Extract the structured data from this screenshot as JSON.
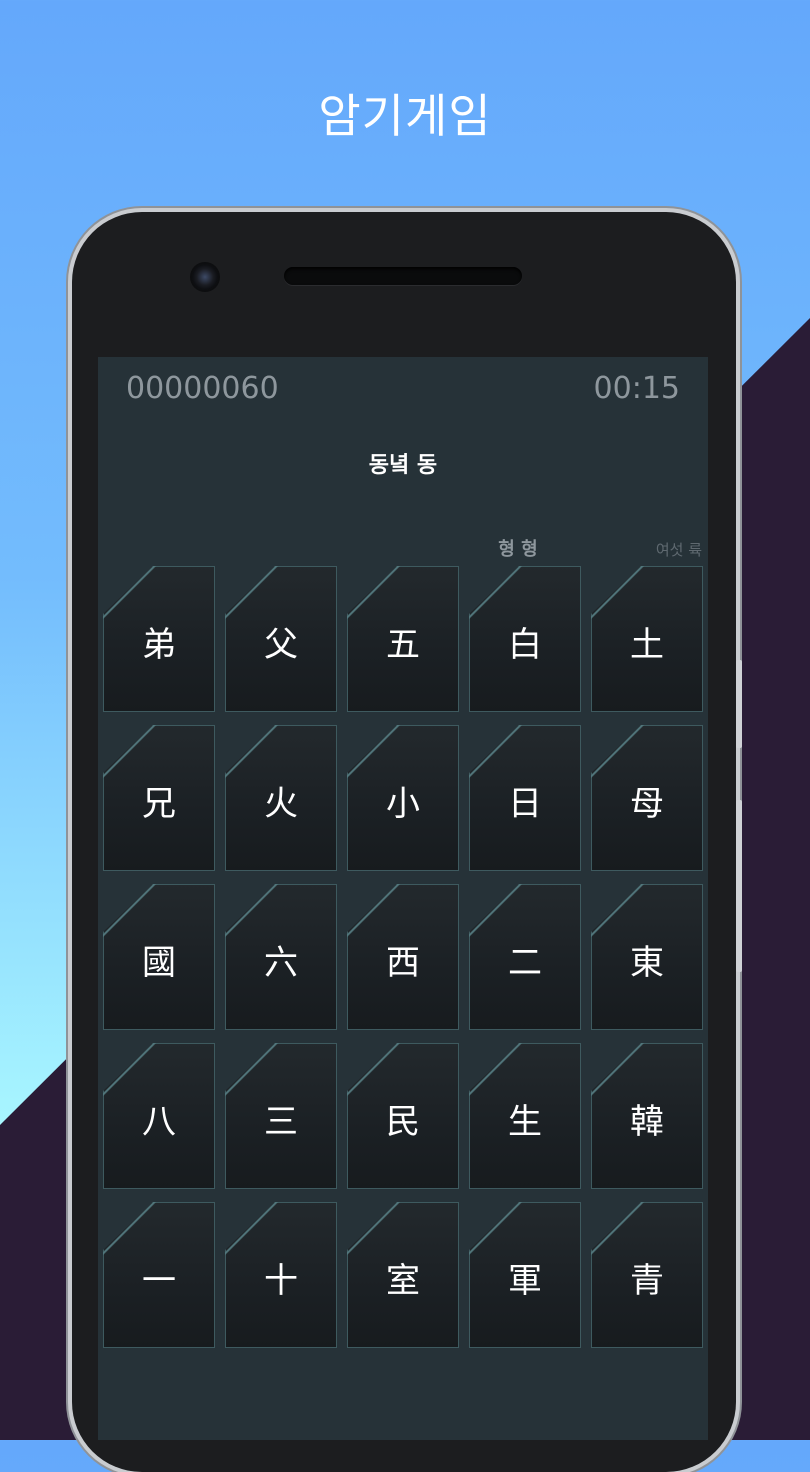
{
  "promo": {
    "title": "암기게임"
  },
  "game": {
    "score": "00000060",
    "timer": "00:15",
    "prompt": "동녘 동",
    "recent_answers": [
      "형 형",
      "여섯 륙"
    ]
  },
  "tiles": [
    [
      "弟",
      "父",
      "五",
      "白",
      "土"
    ],
    [
      "兄",
      "火",
      "小",
      "日",
      "母"
    ],
    [
      "國",
      "六",
      "西",
      "二",
      "東"
    ],
    [
      "八",
      "三",
      "民",
      "生",
      "韓"
    ],
    [
      "一",
      "十",
      "室",
      "軍",
      "青"
    ]
  ],
  "selected_tile": "東",
  "colors": {
    "background_top": "#64a8fb",
    "background_bottom": "#aaf9ff",
    "diagonal_band": "#2a1c36",
    "screen_bg": "#263238",
    "tile_bg": "#1b2024",
    "tile_border": "#3e5a5f",
    "marker": "#e02020",
    "text_muted": "#8e979d"
  }
}
